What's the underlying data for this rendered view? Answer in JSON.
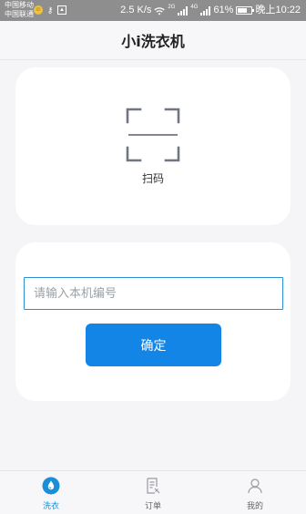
{
  "status_bar": {
    "carrier_1": "中国移动",
    "carrier_2": "中国联通",
    "speed": "2.5 K/s",
    "signal_tag_1": "2G",
    "signal_tag_2": "4G",
    "battery": "61%",
    "time": "晚上10:22"
  },
  "header": {
    "title": "小i洗衣机"
  },
  "scan": {
    "label": "扫码",
    "icon": "scan-frame-icon"
  },
  "machine": {
    "placeholder": "请输入本机编号",
    "value": "",
    "confirm_label": "确定"
  },
  "tabs": [
    {
      "label": "洗衣",
      "icon": "water-drop-icon",
      "active": true
    },
    {
      "label": "订单",
      "icon": "order-document-icon",
      "active": false
    },
    {
      "label": "我的",
      "icon": "profile-icon",
      "active": false
    }
  ],
  "colors": {
    "accent": "#1385e6",
    "active_tab": "#1a8fd8",
    "background": "#f5f5f7",
    "card": "#ffffff"
  }
}
